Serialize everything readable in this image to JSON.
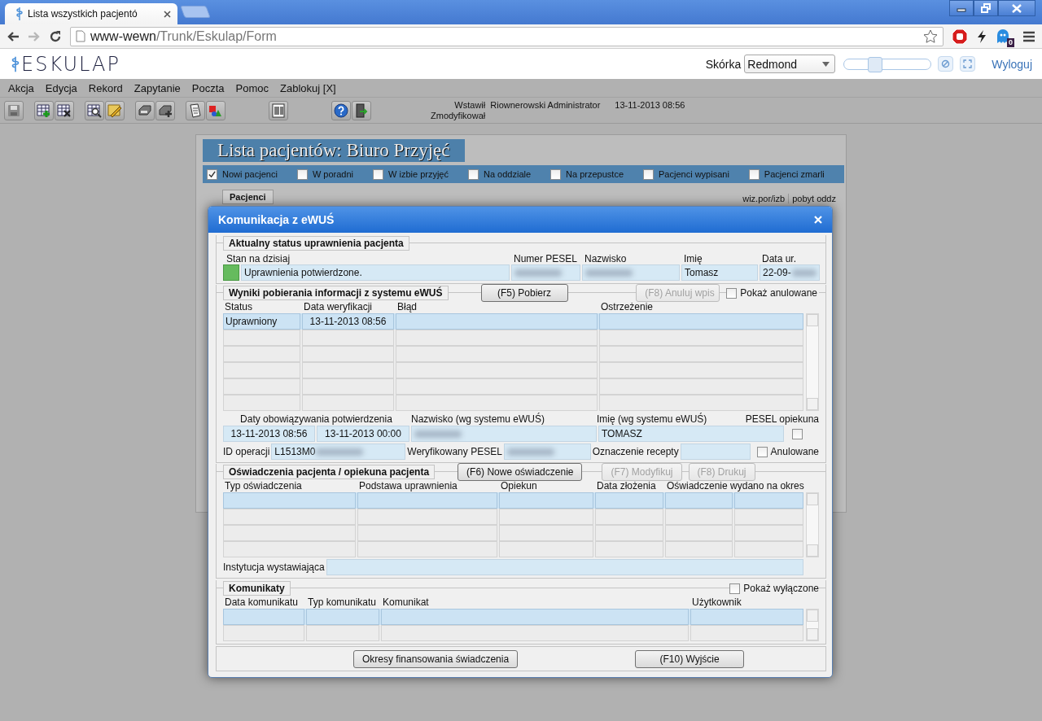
{
  "browser": {
    "tab": {
      "title": "Lista wszystkich pacjentó",
      "selected": true
    },
    "url_host": "www-wewn",
    "url_path": "/Trunk/Eskulap/Form",
    "extension_badge": "0"
  },
  "app_header": {
    "logo": "ESKULAP",
    "skin_label": "Skórka",
    "skin_value": "Redmond",
    "zoom": {
      "level": 0.33
    },
    "logout": "Wyloguj"
  },
  "menu": [
    "Akcja",
    "Edycja",
    "Rekord",
    "Zapytanie",
    "Poczta",
    "Pomoc",
    "Zablokuj [X]"
  ],
  "audit": [
    {
      "label": "Wstawił",
      "user": "Riownerowski Administrator",
      "time": "13-11-2013 08:56"
    },
    {
      "label": "Zmodyfikował"
    }
  ],
  "background_page": {
    "title": "Lista pacjentów: Biuro Przyjęć",
    "filters": [
      {
        "label": "Nowi pacjenci",
        "checked": true
      },
      {
        "label": "W poradni",
        "checked": false
      },
      {
        "label": "W izbie przyjęć",
        "checked": false
      },
      {
        "label": "Na oddziale",
        "checked": false
      },
      {
        "label": "Na przepustce",
        "checked": false
      },
      {
        "label": "Pacjenci wypisani",
        "checked": false
      },
      {
        "label": "Pacjenci zmarli",
        "checked": false
      }
    ],
    "tab": "Pacjenci",
    "column_headers": [
      "wiz.por/izb",
      "pobyt oddz"
    ]
  },
  "dialog": {
    "title": "Komunikacja z eWUŚ",
    "status_section": {
      "legend": "Aktualny status uprawnienia pacjenta",
      "indicator": {
        "color": "#66bb5e"
      },
      "fields": [
        {
          "label": "Stan na dzisiaj",
          "value": "Uprawnienia potwierdzone."
        },
        {
          "label": "Numer PESEL",
          "redacted": true
        },
        {
          "label": "Nazwisko",
          "redacted": true
        },
        {
          "label": "Imię",
          "value": "Tomasz"
        },
        {
          "label": "Data ur.",
          "value": "22-09-",
          "redacted": true
        }
      ]
    },
    "results_section": {
      "legend": "Wyniki pobierania informacji z systemu eWUŚ",
      "buttons": [
        {
          "label": "(F5) Pobierz",
          "disabled": false
        },
        {
          "label": "(F8) Anuluj wpis",
          "disabled": true
        }
      ],
      "show_cancelled": {
        "label": "Pokaż anulowane",
        "checked": false
      },
      "table": {
        "columns": [
          "Status",
          "Data weryfikacji",
          "Błąd",
          "Ostrzeżenie"
        ],
        "rows": [
          {
            "selected": true,
            "cells": [
              "Uprawniony",
              "13-11-2013 08:56"
            ]
          },
          {
            "selected": false
          },
          {
            "selected": false
          },
          {
            "selected": false
          },
          {
            "selected": false
          },
          {
            "selected": false
          }
        ]
      },
      "confirmation_dates": {
        "label": "Daty obowiązywania potwierdzenia",
        "from": "13-11-2013 08:56",
        "to": "13-11-2013 00:00"
      },
      "surname_ewus": {
        "label": "Nazwisko (wg systemu eWUŚ)",
        "redacted": true
      },
      "name_ewus": {
        "label": "Imię (wg systemu eWUŚ)",
        "value": "TOMASZ"
      },
      "guardian_pesel": {
        "label": "PESEL opiekuna",
        "checked": false
      },
      "operation_id": {
        "label": "ID operacji",
        "value": "L1513M0",
        "redacted": true
      },
      "verified_pesel": {
        "label": "Weryfikowany PESEL",
        "redacted": true
      },
      "prescription_mark": {
        "label": "Oznaczenie recepty"
      },
      "cancelled": {
        "label": "Anulowane",
        "checked": false
      }
    },
    "statements_section": {
      "legend": "Oświadczenia pacjenta / opiekuna pacjenta",
      "buttons": [
        {
          "label": "(F6) Nowe oświadczenie",
          "disabled": false
        },
        {
          "label": "(F7) Modyfikuj",
          "disabled": true
        },
        {
          "label": "(F8) Drukuj",
          "disabled": true
        }
      ],
      "table": {
        "columns": [
          "Typ oświadczenia",
          "Podstawa uprawnienia",
          "Opiekun",
          "Data złożenia",
          "Oświadczenie wydano na okres"
        ],
        "rows": [
          {
            "selected": true
          },
          {
            "selected": false
          },
          {
            "selected": false
          },
          {
            "selected": false
          }
        ]
      },
      "issuer": {
        "label": "Instytucja wystawiająca"
      }
    },
    "messages_section": {
      "legend": "Komunikaty",
      "show_disabled": {
        "label": "Pokaż wyłączone",
        "checked": false
      },
      "table": {
        "columns": [
          "Data komunikatu",
          "Typ komunikatu",
          "Komunikat",
          "Użytkownik"
        ],
        "rows": [
          {
            "selected": true
          },
          {
            "selected": false
          }
        ]
      }
    },
    "footer_buttons": [
      "Okresy finansowania świadczenia",
      "(F10) Wyjście"
    ]
  }
}
